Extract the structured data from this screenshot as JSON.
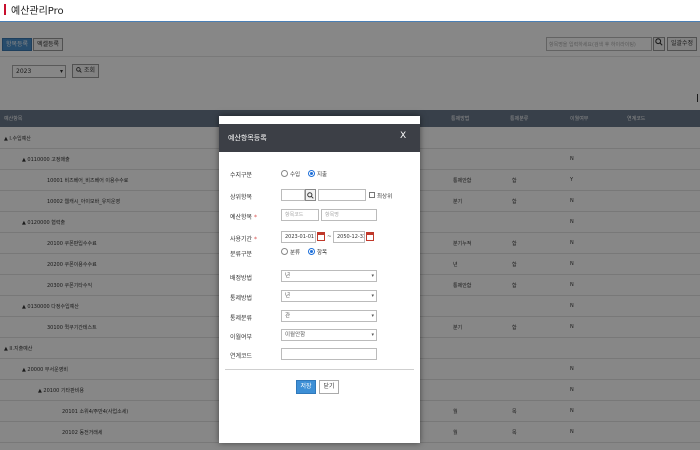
{
  "app": {
    "title": "예산관리Pro"
  },
  "toolbar": {
    "tabs": [
      {
        "label": "항목등록",
        "active": true
      },
      {
        "label": "엑셀등록",
        "active": false
      }
    ],
    "search_placeholder": "항목명을 입력하세요(검색 후 하이라이팅)",
    "search_icon": "search-icon",
    "collapse_icon": "fullscreen-icon",
    "save_order_label": "일괄수정"
  },
  "filter": {
    "year": "2023",
    "lookup_label": "조회"
  },
  "grid": {
    "columns": [
      "예산항목",
      "통제방법",
      "통제분류",
      "이월여부",
      "연계코드"
    ],
    "rows": [
      {
        "name": "▲ I.수입예산",
        "indent": 4,
        "control_method": "",
        "control_class": "",
        "carryover": ""
      },
      {
        "name": "▲ 0110000 고정매출",
        "indent": 22,
        "control_method": "",
        "control_class": "",
        "carryover": "N"
      },
      {
        "name": "10001 비즈베어_비즈베어 이용수수료",
        "indent": 47,
        "control_method": "통제안함",
        "control_class": "합",
        "carryover": "Y"
      },
      {
        "name": "10002 웹캐시_아이모바_유지운영",
        "indent": 47,
        "control_method": "분기",
        "control_class": "합",
        "carryover": "N"
      },
      {
        "name": "▲ 0120000 협력출",
        "indent": 22,
        "control_method": "",
        "control_class": "",
        "carryover": "N"
      },
      {
        "name": "20100 쿠폰판입수수료",
        "indent": 47,
        "control_method": "분기누적",
        "control_class": "합",
        "carryover": "N"
      },
      {
        "name": "20200 쿠폰이용수수료",
        "indent": 47,
        "control_method": "년",
        "control_class": "합",
        "carryover": "N"
      },
      {
        "name": "20300 쿠폰기타수익",
        "indent": 47,
        "control_method": "통제안함",
        "control_class": "합",
        "carryover": "N"
      },
      {
        "name": "▲ 0130000 다정수입예산",
        "indent": 22,
        "control_method": "",
        "control_class": "",
        "carryover": "N"
      },
      {
        "name": "30100 퀵쿠기간테스트",
        "indent": 47,
        "control_method": "분기",
        "control_class": "합",
        "carryover": "N"
      },
      {
        "name": "▲ II.지출예산",
        "indent": 4,
        "control_method": "",
        "control_class": "",
        "carryover": ""
      },
      {
        "name": "▲ 20000 부서운영비",
        "indent": 22,
        "control_method": "",
        "control_class": "",
        "carryover": "N"
      },
      {
        "name": "▲ 20100 기타판비용",
        "indent": 38,
        "control_method": "",
        "control_class": "",
        "carryover": "N"
      },
      {
        "name": "20101 소위4/주만4(사업소세)",
        "indent": 62,
        "control_method": "월",
        "control_class": "목",
        "carryover": "N"
      },
      {
        "name": "20102 동전거래세",
        "indent": 62,
        "control_method": "월",
        "control_class": "목",
        "carryover": "N"
      }
    ]
  },
  "dialog": {
    "title": "예산항목등록",
    "close_label": "X",
    "fields": {
      "income_type": {
        "label": "수지구분",
        "options": [
          "수입",
          "지출"
        ],
        "selected": "지출"
      },
      "parent_item": {
        "label": "상위항목",
        "code": "",
        "name": "",
        "top_label": "최상위"
      },
      "budget_item": {
        "label": "예산항목",
        "required": "*",
        "code_placeholder": "항목코드",
        "name_placeholder": "항목명"
      },
      "period": {
        "label": "사용기간",
        "required": "*",
        "start": "2023-01-01",
        "sep": "~",
        "end": "2050-12-31"
      },
      "category_type": {
        "label": "분류구분",
        "options": [
          "분류",
          "항목"
        ],
        "selected": "항목"
      },
      "allocation_method": {
        "label": "배정방법",
        "value": "년"
      },
      "control_method": {
        "label": "통제방법",
        "value": "년"
      },
      "control_class": {
        "label": "통제분류",
        "value": "관"
      },
      "carryover": {
        "label": "이월여부",
        "value": "이월안함"
      },
      "link_code": {
        "label": "연계코드",
        "value": ""
      }
    },
    "save_label": "저장",
    "cancel_label": "닫기"
  },
  "colors": {
    "accent": "#3d8fd6",
    "header_bar": "#3c3f46",
    "grid_header": "#6b7a8c",
    "brand_mark": "#c8102e"
  }
}
